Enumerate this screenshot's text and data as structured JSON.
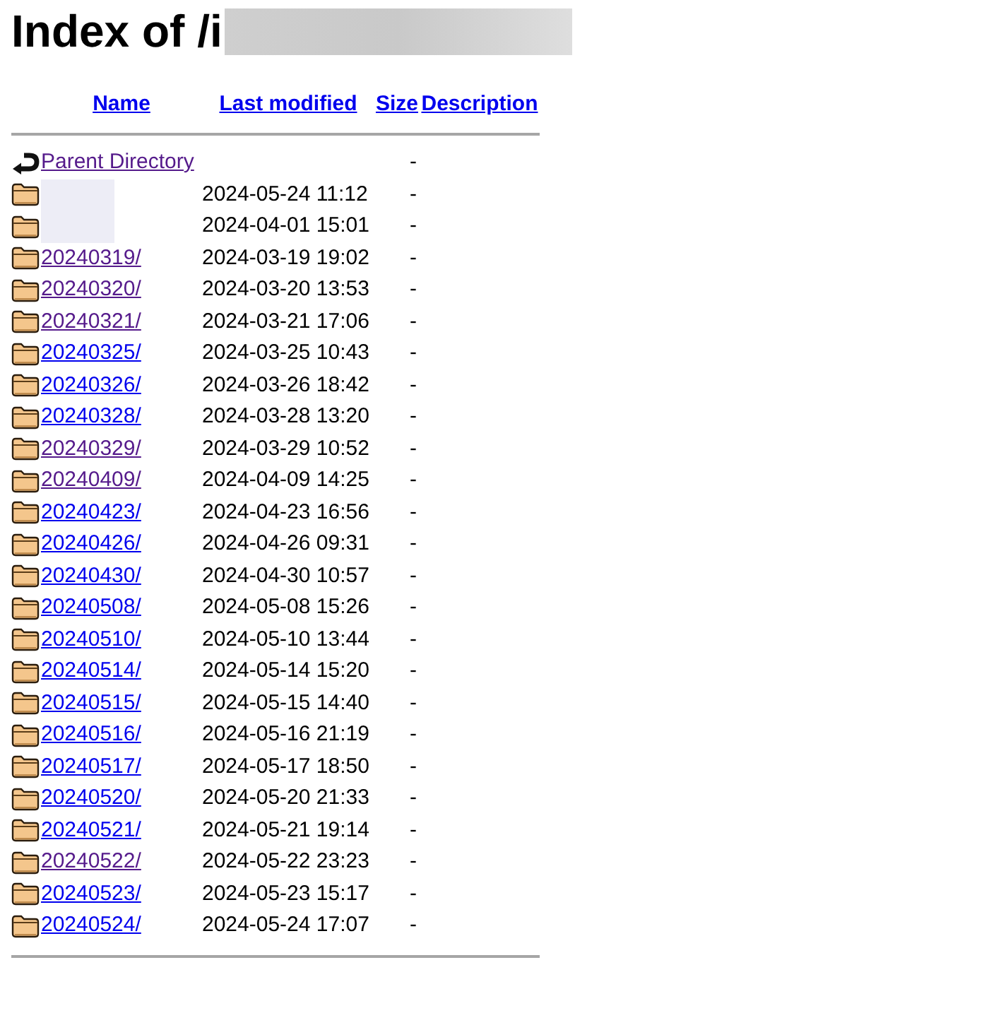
{
  "title": {
    "text": "Index of /i",
    "redacted": true
  },
  "columns": [
    {
      "label": "Name"
    },
    {
      "label": "Last modified"
    },
    {
      "label": "Size"
    },
    {
      "label": "Description"
    }
  ],
  "rows": [
    {
      "kind": "parent",
      "name": "Parent Directory",
      "visited": true,
      "size": "-"
    },
    {
      "kind": "folder",
      "redacted": true,
      "modified": "2024-05-24 11:12",
      "size": "-"
    },
    {
      "kind": "folder",
      "redacted": true,
      "modified": "2024-04-01 15:01",
      "size": "-"
    },
    {
      "kind": "folder",
      "name": "20240319/",
      "visited": true,
      "modified": "2024-03-19 19:02",
      "size": "-"
    },
    {
      "kind": "folder",
      "name": "20240320/",
      "visited": true,
      "modified": "2024-03-20 13:53",
      "size": "-"
    },
    {
      "kind": "folder",
      "name": "20240321/",
      "visited": true,
      "modified": "2024-03-21 17:06",
      "size": "-"
    },
    {
      "kind": "folder",
      "name": "20240325/",
      "visited": false,
      "modified": "2024-03-25 10:43",
      "size": "-"
    },
    {
      "kind": "folder",
      "name": "20240326/",
      "visited": false,
      "modified": "2024-03-26 18:42",
      "size": "-"
    },
    {
      "kind": "folder",
      "name": "20240328/",
      "visited": false,
      "modified": "2024-03-28 13:20",
      "size": "-"
    },
    {
      "kind": "folder",
      "name": "20240329/",
      "visited": true,
      "modified": "2024-03-29 10:52",
      "size": "-"
    },
    {
      "kind": "folder",
      "name": "20240409/",
      "visited": true,
      "modified": "2024-04-09 14:25",
      "size": "-"
    },
    {
      "kind": "folder",
      "name": "20240423/",
      "visited": false,
      "modified": "2024-04-23 16:56",
      "size": "-"
    },
    {
      "kind": "folder",
      "name": "20240426/",
      "visited": false,
      "modified": "2024-04-26 09:31",
      "size": "-"
    },
    {
      "kind": "folder",
      "name": "20240430/",
      "visited": false,
      "modified": "2024-04-30 10:57",
      "size": "-"
    },
    {
      "kind": "folder",
      "name": "20240508/",
      "visited": false,
      "modified": "2024-05-08 15:26",
      "size": "-"
    },
    {
      "kind": "folder",
      "name": "20240510/",
      "visited": false,
      "modified": "2024-05-10 13:44",
      "size": "-"
    },
    {
      "kind": "folder",
      "name": "20240514/",
      "visited": false,
      "modified": "2024-05-14 15:20",
      "size": "-"
    },
    {
      "kind": "folder",
      "name": "20240515/",
      "visited": false,
      "modified": "2024-05-15 14:40",
      "size": "-"
    },
    {
      "kind": "folder",
      "name": "20240516/",
      "visited": false,
      "modified": "2024-05-16 21:19",
      "size": "-"
    },
    {
      "kind": "folder",
      "name": "20240517/",
      "visited": false,
      "modified": "2024-05-17 18:50",
      "size": "-"
    },
    {
      "kind": "folder",
      "name": "20240520/",
      "visited": false,
      "modified": "2024-05-20 21:33",
      "size": "-"
    },
    {
      "kind": "folder",
      "name": "20240521/",
      "visited": false,
      "modified": "2024-05-21 19:14",
      "size": "-"
    },
    {
      "kind": "folder",
      "name": "20240522/",
      "visited": true,
      "modified": "2024-05-22 23:23",
      "size": "-"
    },
    {
      "kind": "folder",
      "name": "20240523/",
      "visited": false,
      "modified": "2024-05-23 15:17",
      "size": "-"
    },
    {
      "kind": "folder",
      "name": "20240524/",
      "visited": false,
      "modified": "2024-05-24 17:07",
      "size": "-"
    }
  ]
}
